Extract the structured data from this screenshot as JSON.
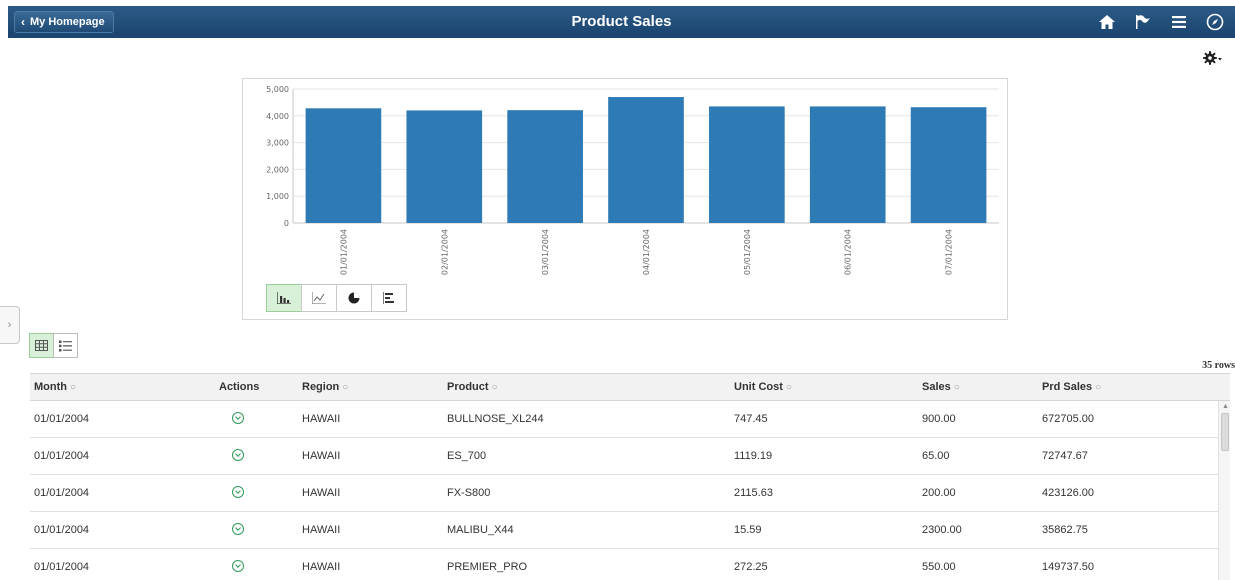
{
  "banner": {
    "back_label": "My Homepage",
    "title": "Product Sales",
    "icons": [
      "home-icon",
      "flag-icon",
      "menu-icon",
      "navigator-icon"
    ]
  },
  "settings_icon": "gear-icon",
  "chart_data": {
    "type": "bar",
    "categories": [
      "01/01/2004",
      "02/01/2004",
      "03/01/2004",
      "04/01/2004",
      "05/01/2004",
      "06/01/2004",
      "07/01/2004"
    ],
    "values": [
      4280,
      4200,
      4210,
      4700,
      4350,
      4350,
      4320
    ],
    "y_ticks": [
      "0",
      "1,000",
      "2,000",
      "3,000",
      "4,000",
      "5,000"
    ],
    "ylim": [
      0,
      5000
    ],
    "bar_color": "#2e7ab5",
    "grid": true
  },
  "chart_types": [
    "bar-chart-icon",
    "line-chart-icon",
    "pie-chart-icon",
    "horizontal-bar-icon"
  ],
  "view_toggle": [
    "grid-view-icon",
    "list-view-icon"
  ],
  "row_count": "35 rows",
  "grid": {
    "headers": {
      "month": "Month",
      "actions": "Actions",
      "region": "Region",
      "product": "Product",
      "unit_cost": "Unit Cost",
      "sales": "Sales",
      "prd_sales": "Prd Sales"
    },
    "rows": [
      {
        "month": "01/01/2004",
        "region": "HAWAII",
        "product": "BULLNOSE_XL244",
        "unit_cost": "747.45",
        "sales": "900.00",
        "prd_sales": "672705.00"
      },
      {
        "month": "01/01/2004",
        "region": "HAWAII",
        "product": "ES_700",
        "unit_cost": "1119.19",
        "sales": "65.00",
        "prd_sales": "72747.67"
      },
      {
        "month": "01/01/2004",
        "region": "HAWAII",
        "product": "FX-S800",
        "unit_cost": "2115.63",
        "sales": "200.00",
        "prd_sales": "423126.00"
      },
      {
        "month": "01/01/2004",
        "region": "HAWAII",
        "product": "MALIBU_X44",
        "unit_cost": "15.59",
        "sales": "2300.00",
        "prd_sales": "35862.75"
      },
      {
        "month": "01/01/2004",
        "region": "HAWAII",
        "product": "PREMIER_PRO",
        "unit_cost": "272.25",
        "sales": "550.00",
        "prd_sales": "149737.50"
      }
    ]
  }
}
